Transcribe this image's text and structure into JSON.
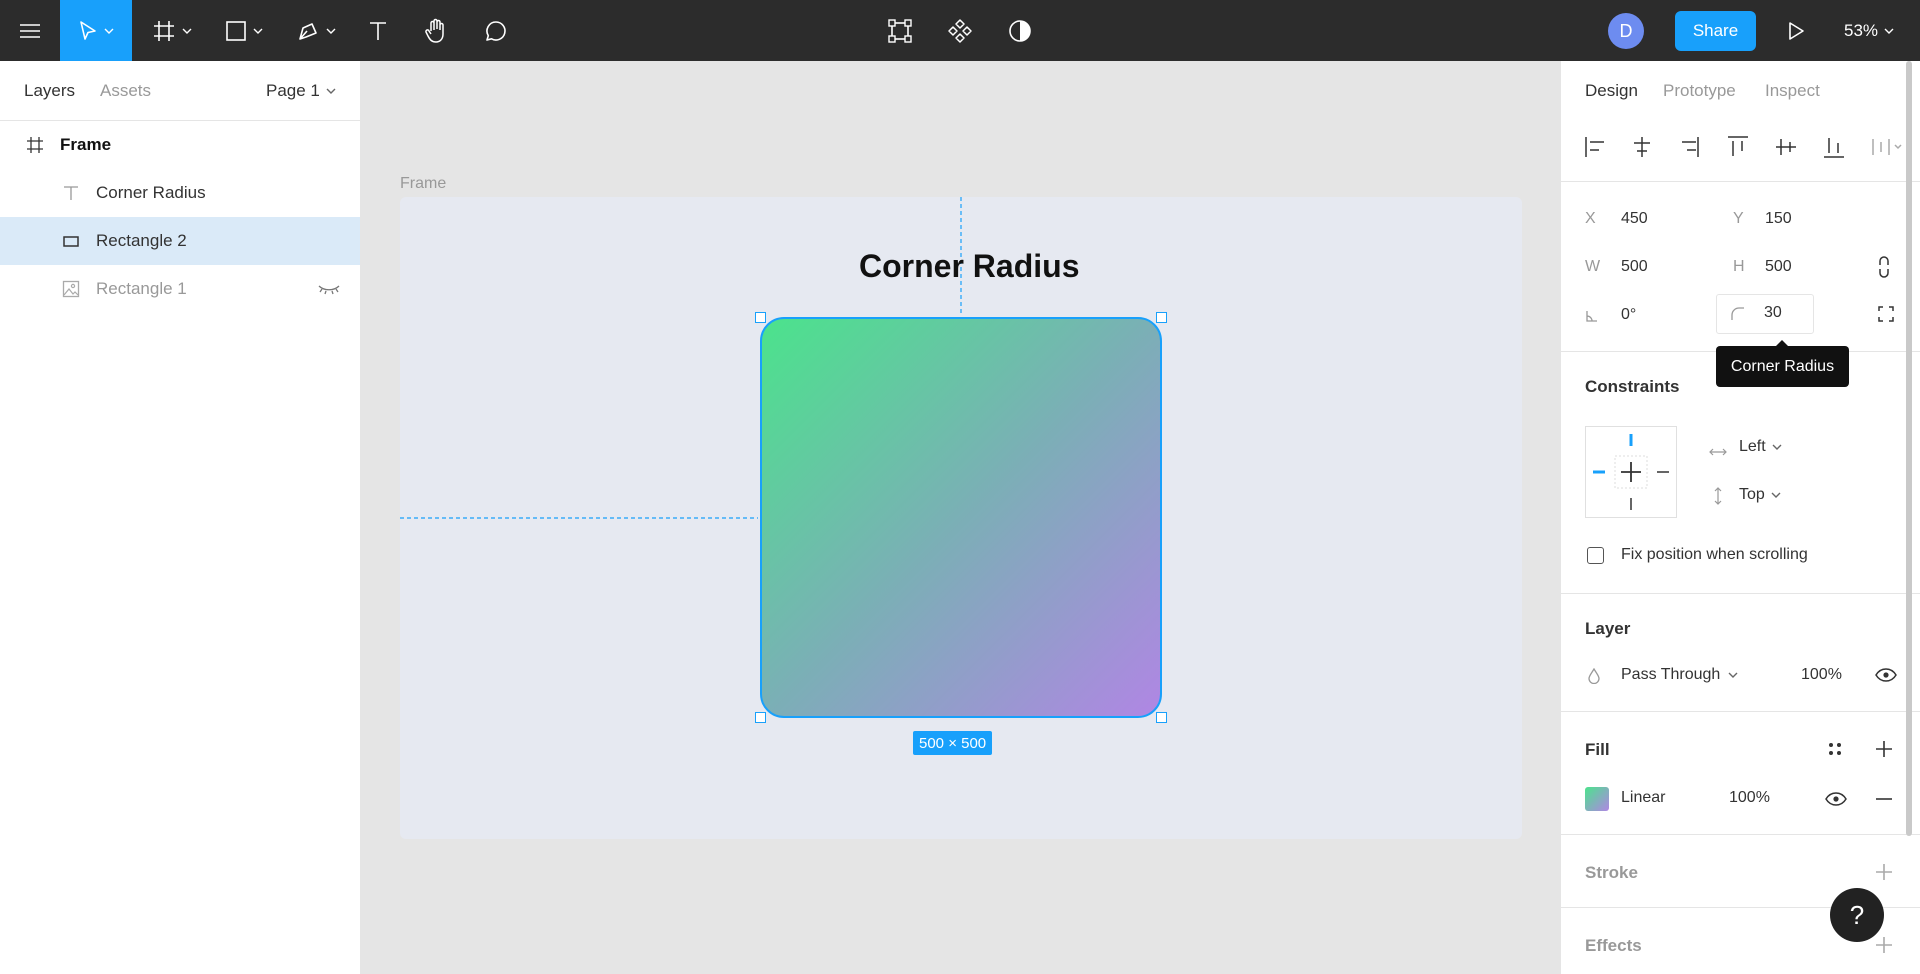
{
  "toolbar": {
    "avatar_initial": "D",
    "share_label": "Share",
    "zoom": "53%"
  },
  "left_panel": {
    "tabs": {
      "layers": "Layers",
      "assets": "Assets"
    },
    "page_selector": "Page 1",
    "layers": [
      {
        "label": "Frame",
        "icon": "frame-icon"
      },
      {
        "label": "Corner Radius",
        "icon": "text-icon"
      },
      {
        "label": "Rectangle 2",
        "icon": "rectangle-icon",
        "selected": true
      },
      {
        "label": "Rectangle 1",
        "icon": "image-icon",
        "hidden": true
      }
    ]
  },
  "canvas": {
    "frame_label": "Frame",
    "title_text": "Corner Radius",
    "dimension_badge": "500 × 500",
    "accent": "#18a0fb",
    "gradient": [
      "#4be38c",
      "#b086e4"
    ]
  },
  "right_panel": {
    "tabs": {
      "design": "Design",
      "prototype": "Prototype",
      "inspect": "Inspect"
    },
    "x_label": "X",
    "x_value": "450",
    "y_label": "Y",
    "y_value": "150",
    "w_label": "W",
    "w_value": "500",
    "h_label": "H",
    "h_value": "500",
    "rotation_value": "0°",
    "corner_radius_value": "30",
    "tooltip": "Corner Radius",
    "constraints_title": "Constraints",
    "constraint_h": "Left",
    "constraint_v": "Top",
    "fix_position_label": "Fix position when scrolling",
    "layer_title": "Layer",
    "blend_mode": "Pass Through",
    "layer_opacity": "100%",
    "fill_title": "Fill",
    "fill_type": "Linear",
    "fill_opacity": "100%",
    "stroke_title": "Stroke",
    "effects_title": "Effects",
    "help_label": "?"
  }
}
